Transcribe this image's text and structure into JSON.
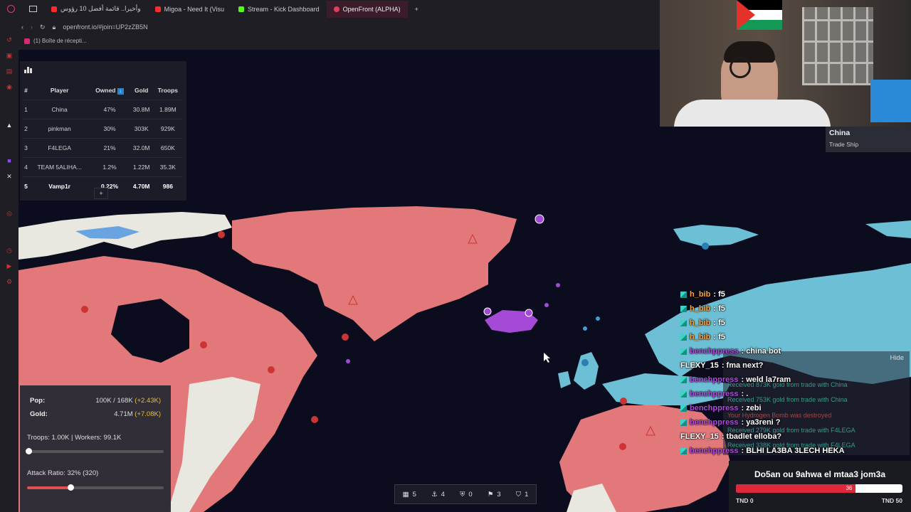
{
  "browser": {
    "tabs": [
      {
        "label": "وأخيرا.. قائمة أفضل 10 رؤوس",
        "color": "#ff2a2a"
      },
      {
        "label": "Migoa - Need It (Visu",
        "color": "#ff2a2a"
      },
      {
        "label": "Stream - Kick Dashboard",
        "color": "#53fc18"
      },
      {
        "label": "OpenFront (ALPHA)",
        "color": "#e04060"
      }
    ],
    "new_tab_label": "+",
    "url": "openfront.io/#join=UP2zZB5N",
    "bookmark_label": "(1) Boîte de récepti..."
  },
  "leaderboard": {
    "columns": [
      "#",
      "Player",
      "Owned",
      "Gold",
      "Troops"
    ],
    "rows": [
      {
        "rank": "1",
        "player": "China",
        "owned": "47%",
        "gold": "30.8M",
        "troops": "1.89M"
      },
      {
        "rank": "2",
        "player": "pinkman",
        "owned": "30%",
        "gold": "303K",
        "troops": "929K"
      },
      {
        "rank": "3",
        "player": "F4LEGA",
        "owned": "21%",
        "gold": "32.0M",
        "troops": "650K"
      },
      {
        "rank": "4",
        "player": "TEAM 5ALIHA...",
        "owned": "1.2%",
        "gold": "1.22M",
        "troops": "35.3K"
      },
      {
        "rank": "5",
        "player": "Vamp1r",
        "owned": "0.22%",
        "gold": "4.70M",
        "troops": "986"
      }
    ],
    "expand_label": "+"
  },
  "tooltip": {
    "name": "China",
    "type": "Trade Ship"
  },
  "stats": {
    "pop_label": "Pop:",
    "pop_value": "100K / 168K",
    "pop_delta": "(+2.43K)",
    "gold_label": "Gold:",
    "gold_value": "4.71M",
    "gold_delta": "(+7.08K)",
    "troops_workers": "Troops: 1.00K | Workers: 99.1K",
    "troop_ratio": 0.01,
    "attack_ratio_label": "Attack Ratio: 32% (320)",
    "attack_ratio": 0.32
  },
  "chat": [
    {
      "user": "h_bib",
      "color": "orange",
      "badge": true,
      "msg": ": f5"
    },
    {
      "user": "h_bib",
      "color": "orange",
      "badge": true,
      "msg": ": f5"
    },
    {
      "user": "h_bib",
      "color": "orange",
      "badge": true,
      "msg": ": f5"
    },
    {
      "user": "h_bib",
      "color": "orange",
      "badge": true,
      "msg": ": f5"
    },
    {
      "user": "benchppress",
      "color": "purple",
      "badge": true,
      "msg": ": china bot"
    },
    {
      "user": "FLEXY_15",
      "color": "white",
      "badge": false,
      "msg": ": fma next?"
    },
    {
      "user": "benchppress",
      "color": "purple",
      "badge": true,
      "msg": ": weld la7ram"
    },
    {
      "user": "benchppress",
      "color": "purple",
      "badge": true,
      "msg": ": ."
    },
    {
      "user": "benchppress",
      "color": "purple",
      "badge": true,
      "msg": ": zebi"
    },
    {
      "user": "benchppress",
      "color": "purple",
      "badge": true,
      "msg": ": ya3reni ?"
    },
    {
      "user": "FLEXY_15",
      "color": "white",
      "badge": false,
      "msg": ": tbadlet elloba?"
    },
    {
      "user": "benchppress",
      "color": "purple",
      "badge": true,
      "msg": ": BLHI LA3BA 3LECH HEKA"
    }
  ],
  "events": {
    "hide_label": "Hide",
    "lines": [
      {
        "text": "Received 873K gold from trade with China",
        "color": "#3a9a8a"
      },
      {
        "text": "Received 753K gold from trade with China",
        "color": "#3a9a8a"
      },
      {
        "text": "Your Hydrogen Bomb was destroyed",
        "color": "#9a4a4a"
      },
      {
        "text": "Received 279K gold from trade with F4LEGA",
        "color": "#3a9a8a"
      },
      {
        "text": "Received 338K gold from trade with F4LEGA",
        "color": "#3a9a8a"
      }
    ]
  },
  "poll": {
    "title": "Do5an ou 9ahwa el mtaa3 jom3a",
    "value_label": "36",
    "fill": 0.72,
    "left_label": "TND 0",
    "right_label": "TND 50"
  },
  "controls": [
    {
      "icon": "city-icon",
      "value": "5"
    },
    {
      "icon": "port-icon",
      "value": "4"
    },
    {
      "icon": "defense-icon",
      "value": "0"
    },
    {
      "icon": "silo-icon",
      "value": "3"
    },
    {
      "icon": "sam-icon",
      "value": "1"
    }
  ],
  "colors": {
    "china": "#e3787a",
    "pinkman": "#e8e8e0",
    "f4lega": "#6cbfd4",
    "vamp1r": "#a44ad6",
    "ocean": "#0b0d1e",
    "accent": "#e04060"
  }
}
